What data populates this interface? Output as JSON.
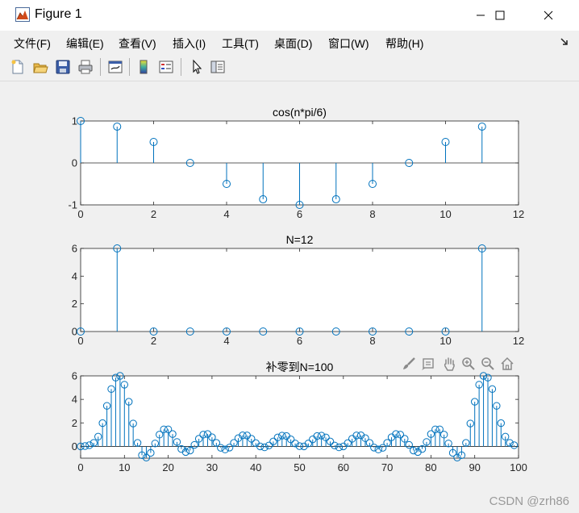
{
  "window": {
    "title": "Figure 1",
    "minimize_label": "—",
    "maximize_label": "☐",
    "close_label": "✕"
  },
  "menu": {
    "items": [
      {
        "label": "文件(F)"
      },
      {
        "label": "编辑(E)"
      },
      {
        "label": "查看(V)"
      },
      {
        "label": "插入(I)"
      },
      {
        "label": "工具(T)"
      },
      {
        "label": "桌面(D)"
      },
      {
        "label": "窗口(W)"
      },
      {
        "label": "帮助(H)"
      }
    ],
    "overflow_icon": "dock-arrow-icon"
  },
  "toolbar": {
    "buttons": [
      "new-figure-icon",
      "open-file-icon",
      "save-icon",
      "print-icon",
      "link-plot-icon",
      "insert-colorbar-icon",
      "insert-legend-icon",
      "edit-plot-icon",
      "property-inspector-icon"
    ]
  },
  "axes_toolbar": [
    "brush-icon",
    "data-tips-icon",
    "pan-icon",
    "zoom-in-icon",
    "zoom-out-icon",
    "home-icon"
  ],
  "colors": {
    "stem": "#0072bd",
    "axis": "#262626",
    "figure_bg": "#f0f0f0"
  },
  "watermark": "CSDN @zrh86",
  "chart_data": [
    {
      "type": "stem",
      "title": "cos(n*pi/6)",
      "x": [
        0,
        1,
        2,
        3,
        4,
        5,
        6,
        7,
        8,
        9,
        10,
        11
      ],
      "values": [
        1,
        0.866,
        0.5,
        0,
        -0.5,
        -0.866,
        -1,
        -0.866,
        -0.5,
        0,
        0.5,
        0.866
      ],
      "xlim": [
        0,
        12
      ],
      "ylim": [
        -1,
        1
      ],
      "xticks": [
        0,
        2,
        4,
        6,
        8,
        10,
        12
      ],
      "yticks": [
        -1,
        0,
        1
      ],
      "xlabel": "",
      "ylabel": "",
      "grid": false
    },
    {
      "type": "stem",
      "title": "N=12",
      "x": [
        0,
        1,
        2,
        3,
        4,
        5,
        6,
        7,
        8,
        9,
        10,
        11
      ],
      "values": [
        0,
        6,
        0,
        0,
        0,
        0,
        0,
        0,
        0,
        0,
        0,
        6
      ],
      "xlim": [
        0,
        12
      ],
      "ylim": [
        0,
        6
      ],
      "xticks": [
        0,
        2,
        4,
        6,
        8,
        10,
        12
      ],
      "yticks": [
        0,
        2,
        4,
        6
      ],
      "xlabel": "",
      "ylabel": "",
      "grid": false
    },
    {
      "type": "stem",
      "title": "补零到N=100",
      "x_start": 0,
      "x_step": 1,
      "values": [
        0,
        0.03,
        0.1,
        0.3,
        0.83,
        1.98,
        3.45,
        4.88,
        5.85,
        6.0,
        5.25,
        3.8,
        1.95,
        0.3,
        -0.75,
        -0.95,
        -0.55,
        0.25,
        1.0,
        1.45,
        1.45,
        1.05,
        0.38,
        -0.22,
        -0.48,
        -0.35,
        0.13,
        0.65,
        1.0,
        1.05,
        0.78,
        0.3,
        -0.12,
        -0.26,
        -0.1,
        0.3,
        0.7,
        0.94,
        0.93,
        0.65,
        0.28,
        0.0,
        -0.08,
        0.08,
        0.42,
        0.76,
        0.92,
        0.88,
        0.6,
        0.25,
        0.02,
        0.0,
        0.25,
        0.6,
        0.88,
        0.92,
        0.76,
        0.42,
        0.08,
        -0.08,
        0.0,
        0.28,
        0.65,
        0.93,
        0.94,
        0.7,
        0.3,
        -0.1,
        -0.26,
        -0.12,
        0.3,
        0.78,
        1.05,
        1.0,
        0.65,
        0.13,
        -0.35,
        -0.48,
        -0.22,
        0.38,
        1.05,
        1.45,
        1.45,
        1.0,
        0.25,
        -0.55,
        -0.95,
        -0.75,
        0.3,
        1.95,
        3.8,
        5.25,
        6.0,
        5.85,
        4.88,
        3.45,
        1.98,
        0.83,
        0.3,
        0.1
      ],
      "xlim": [
        0,
        100
      ],
      "ylim": [
        -1,
        6
      ],
      "xticks": [
        0,
        10,
        20,
        30,
        40,
        50,
        60,
        70,
        80,
        90,
        100
      ],
      "yticks": [
        0,
        2,
        4,
        6
      ],
      "xlabel": "",
      "ylabel": "",
      "grid": false
    }
  ]
}
